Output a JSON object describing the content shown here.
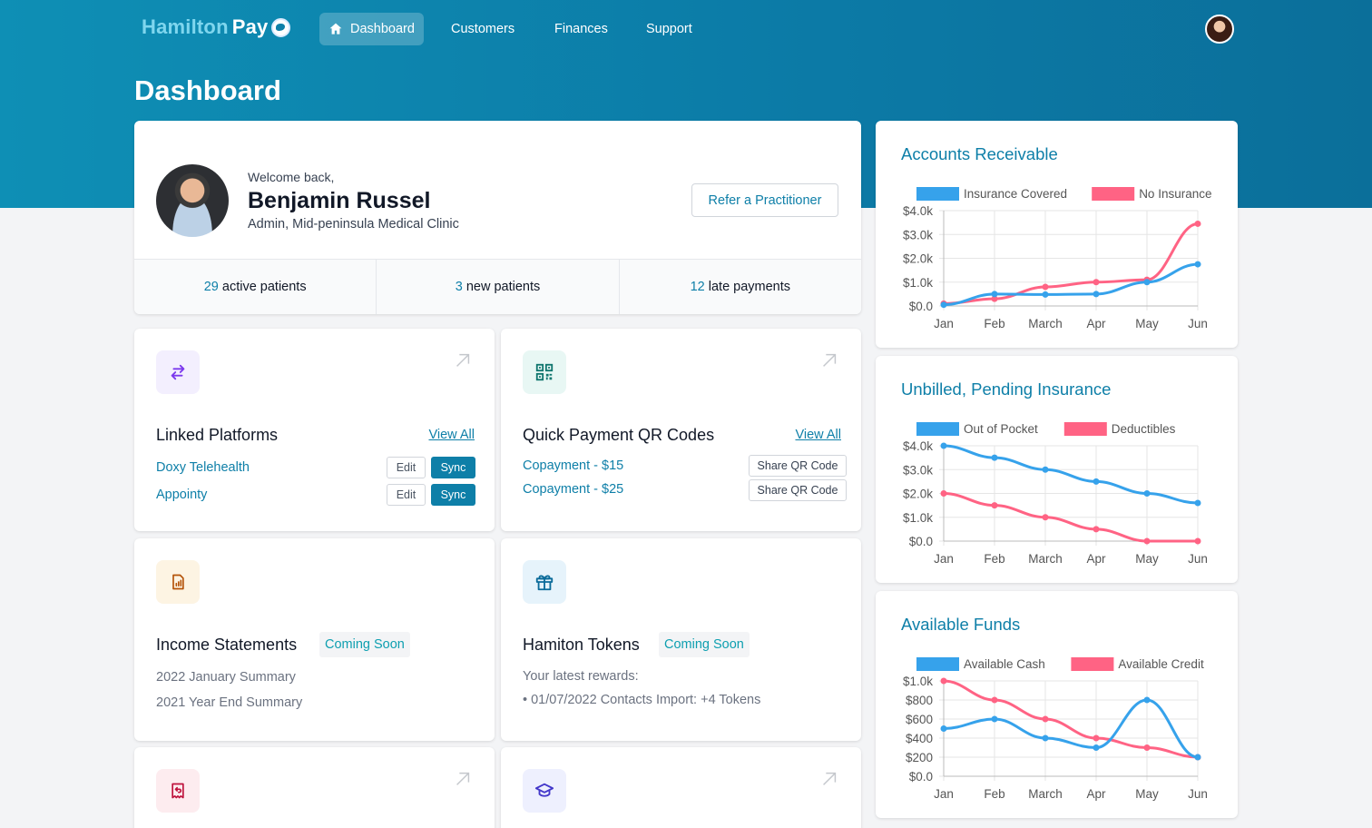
{
  "app": {
    "logo_left": "Hamilton",
    "logo_right": "Pay"
  },
  "nav": [
    {
      "label": "Dashboard",
      "active": true
    },
    {
      "label": "Customers",
      "active": false
    },
    {
      "label": "Finances",
      "active": false
    },
    {
      "label": "Support",
      "active": false
    }
  ],
  "page": {
    "title": "Dashboard"
  },
  "welcome": {
    "greeting": "Welcome back,",
    "name": "Benjamin Russel",
    "role": "Admin, Mid-peninsula Medical Clinic",
    "refer_label": "Refer a Practitioner",
    "stats": [
      {
        "num": "29",
        "label": "active patients"
      },
      {
        "num": "3",
        "label": "new patients"
      },
      {
        "num": "12",
        "label": "late payments"
      }
    ]
  },
  "linked": {
    "title": "Linked Platforms",
    "view_all": "View All",
    "items": [
      {
        "name": "Doxy Telehealth",
        "edit": "Edit",
        "sync": "Sync"
      },
      {
        "name": "Appointy",
        "edit": "Edit",
        "sync": "Sync"
      }
    ]
  },
  "qr": {
    "title": "Quick Payment QR Codes",
    "view_all": "View All",
    "items": [
      {
        "name": "Copayment - $15",
        "share": "Share QR Code"
      },
      {
        "name": "Copayment - $25",
        "share": "Share QR Code"
      }
    ]
  },
  "income": {
    "title": "Income Statements",
    "badge": "Coming Soon",
    "items": [
      "2022 January Summary",
      "2021 Year End Summary"
    ]
  },
  "tokens": {
    "title": "Hamiton Tokens",
    "badge": "Coming Soon",
    "subtitle": "Your latest rewards:",
    "item": "• 01/07/2022  Contacts Import:  +4 Tokens"
  },
  "colors": {
    "blue": "#36a2eb",
    "pink": "#ff6384",
    "accent": "#0e7fa8"
  },
  "icons": [
    "home-icon",
    "arrows-swap-icon",
    "qr-code-icon",
    "document-chart-icon",
    "gift-icon",
    "receipt-refund-icon",
    "academic-cap-icon",
    "arrow-up-right-icon"
  ],
  "chart_data": [
    {
      "type": "line",
      "title": "Accounts Receivable",
      "categories": [
        "Jan",
        "Feb",
        "March",
        "Apr",
        "May",
        "Jun"
      ],
      "y_ticks": [
        "$4.0k",
        "$3.0k",
        "$2.0k",
        "$1.0k",
        "$0.0"
      ],
      "ylim": [
        0,
        4000
      ],
      "legend": "top",
      "grid": true,
      "series": [
        {
          "name": "Insurance Covered",
          "color": "#36a2eb",
          "values": [
            50,
            500,
            480,
            500,
            1000,
            1750
          ]
        },
        {
          "name": "No Insurance",
          "color": "#ff6384",
          "values": [
            100,
            300,
            800,
            1000,
            1100,
            3450
          ]
        }
      ]
    },
    {
      "type": "line",
      "title": "Unbilled, Pending Insurance",
      "categories": [
        "Jan",
        "Feb",
        "March",
        "Apr",
        "May",
        "Jun"
      ],
      "y_ticks": [
        "$4.0k",
        "$3.0k",
        "$2.0k",
        "$1.0k",
        "$0.0"
      ],
      "ylim": [
        0,
        4000
      ],
      "legend": "top",
      "grid": true,
      "series": [
        {
          "name": "Out of Pocket",
          "color": "#36a2eb",
          "values": [
            4000,
            3500,
            3000,
            2500,
            2000,
            1600
          ]
        },
        {
          "name": "Deductibles",
          "color": "#ff6384",
          "values": [
            2000,
            1500,
            1000,
            500,
            0,
            0
          ]
        }
      ]
    },
    {
      "type": "line",
      "title": "Available Funds",
      "categories": [
        "Jan",
        "Feb",
        "March",
        "Apr",
        "May",
        "Jun"
      ],
      "y_ticks": [
        "$1.0k",
        "$800",
        "$600",
        "$400",
        "$200",
        "$0.0"
      ],
      "ylim": [
        0,
        1000
      ],
      "legend": "top",
      "grid": true,
      "series": [
        {
          "name": "Available Cash",
          "color": "#36a2eb",
          "values": [
            500,
            600,
            400,
            300,
            800,
            200
          ]
        },
        {
          "name": "Available Credit",
          "color": "#ff6384",
          "values": [
            1000,
            800,
            600,
            400,
            300,
            200
          ]
        }
      ]
    }
  ]
}
